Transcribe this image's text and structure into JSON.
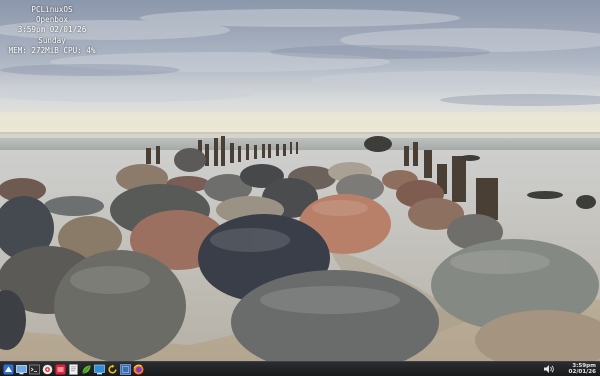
{
  "conky": {
    "line1": "PCLinuxOS",
    "line2": "Openbox",
    "line3": "3:59pm  02/01/26",
    "line4": "Sunday",
    "line5": "MEM: 272MiB CPU: 4%"
  },
  "taskbar": {
    "launchers": [
      {
        "name": "menu-icon",
        "color": "#3a7bd5"
      },
      {
        "name": "show-desktop-icon",
        "color": "#5aa0e0"
      },
      {
        "name": "terminal-icon",
        "color": "#2f2f2f"
      },
      {
        "name": "package-manager-icon",
        "color": "#e0e0e0"
      },
      {
        "name": "red-app-icon",
        "color": "#e0243b"
      },
      {
        "name": "text-editor-icon",
        "color": "#dddddd"
      },
      {
        "name": "leaf-icon",
        "color": "#6cbf3a"
      },
      {
        "name": "control-center-icon",
        "color": "#3aa0dd"
      },
      {
        "name": "refresh-icon",
        "color": "#e8c020"
      },
      {
        "name": "screenshot-icon",
        "color": "#3b6db3"
      },
      {
        "name": "firefox-icon",
        "color": "#ff7a1a"
      }
    ],
    "tray": {
      "volume_icon": "volume-icon",
      "clock_time": "3:59pm",
      "clock_date": "02/01/26"
    }
  }
}
